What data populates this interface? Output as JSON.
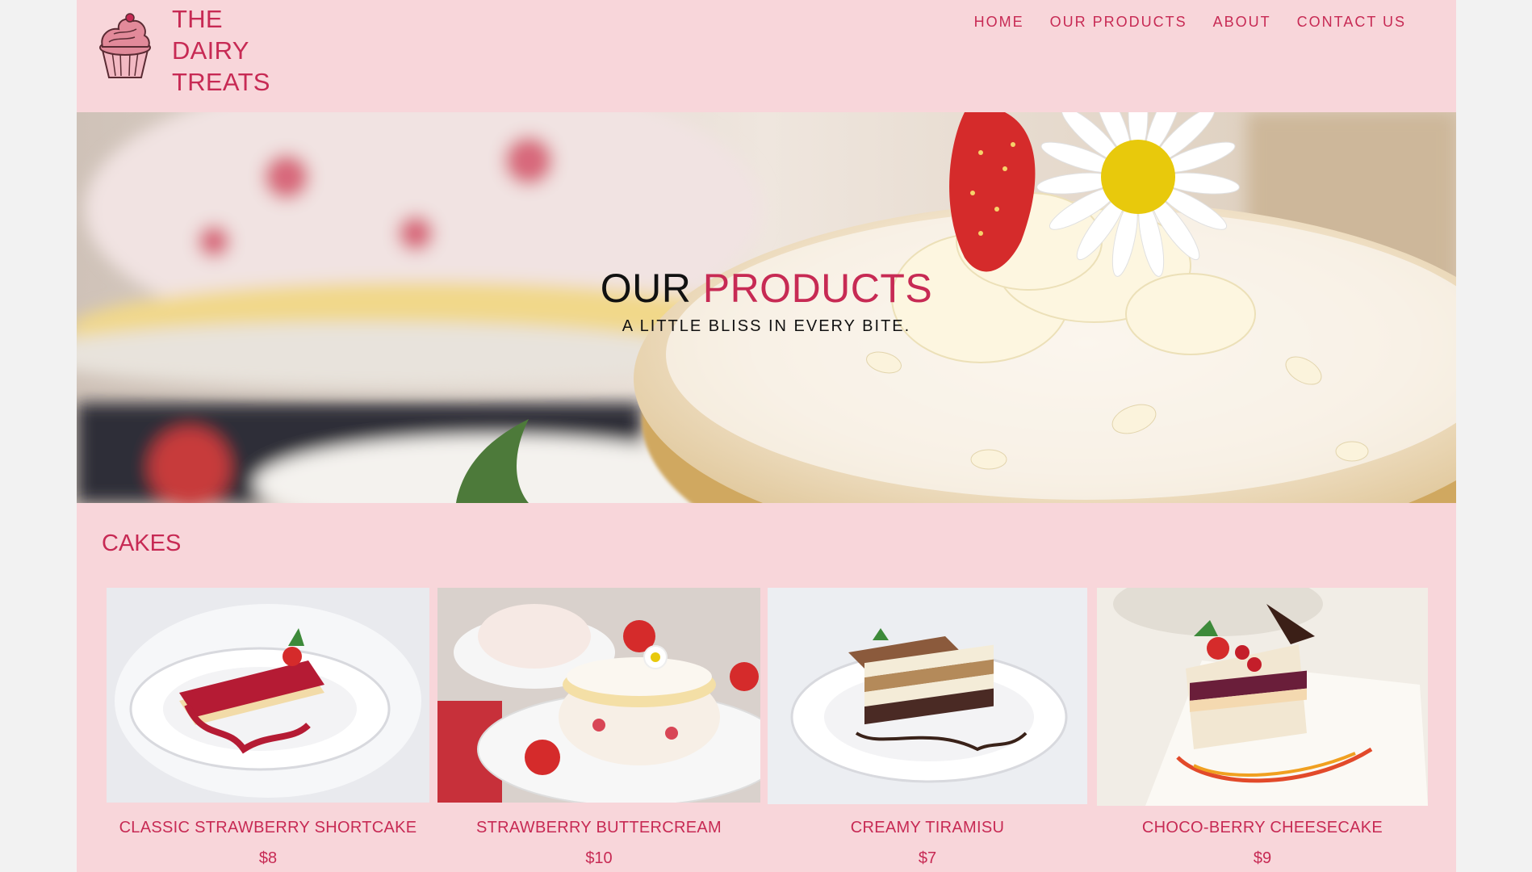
{
  "brand": {
    "line1": "THE",
    "line2": "DAIRY",
    "line3": "TREATS",
    "logo_icon": "cupcake-icon"
  },
  "nav": {
    "items": [
      "HOME",
      "OUR PRODUCTS",
      "ABOUT",
      "CONTACT US"
    ]
  },
  "hero": {
    "title_part1": "OUR",
    "title_part2": "PRODUCTS",
    "subtitle": "A LITTLE BLISS IN EVERY BITE."
  },
  "section": {
    "title": "CAKES"
  },
  "products": [
    {
      "name": "CLASSIC STRAWBERRY SHORTCAKE",
      "price": "$8"
    },
    {
      "name": "STRAWBERRY BUTTERCREAM",
      "price": "$10"
    },
    {
      "name": "CREAMY TIRAMISU",
      "price": "$7"
    },
    {
      "name": "CHOCO-BERRY CHEESECAKE",
      "price": "$9"
    }
  ],
  "colors": {
    "accent": "#c72a54",
    "page_bg": "#f8d6da",
    "outer_bg": "#f2f2f2"
  }
}
